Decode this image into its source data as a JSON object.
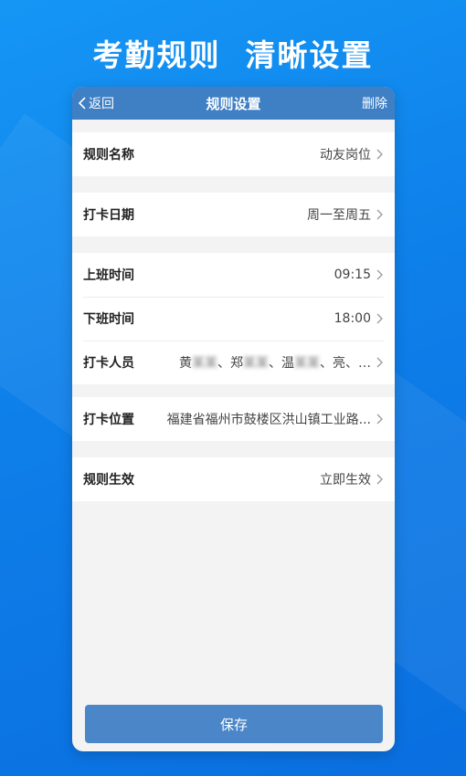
{
  "promo": {
    "title": "考勤规则  清晰设置"
  },
  "navbar": {
    "back_label": "返回",
    "title": "规则设置",
    "delete_label": "删除"
  },
  "rules": {
    "name": {
      "label": "规则名称",
      "value": "动友岗位"
    },
    "date": {
      "label": "打卡日期",
      "value": "周一至周五"
    },
    "start_time": {
      "label": "上班时间",
      "value": "09:15"
    },
    "end_time": {
      "label": "下班时间",
      "value": "18:00"
    },
    "members": {
      "label": "打卡人员",
      "names": [
        "黄",
        "郑",
        "温",
        "亮"
      ],
      "separator": "、",
      "ellipsis": "…"
    },
    "location": {
      "label": "打卡位置",
      "value": "福建省福州市鼓楼区洪山镇工业路..."
    },
    "effective": {
      "label": "规则生效",
      "value": "立即生效"
    }
  },
  "footer": {
    "save_label": "保存"
  },
  "colors": {
    "navbar": "#3f7fc4",
    "save_button": "#4a86c8",
    "background": "#0e7fe9"
  }
}
